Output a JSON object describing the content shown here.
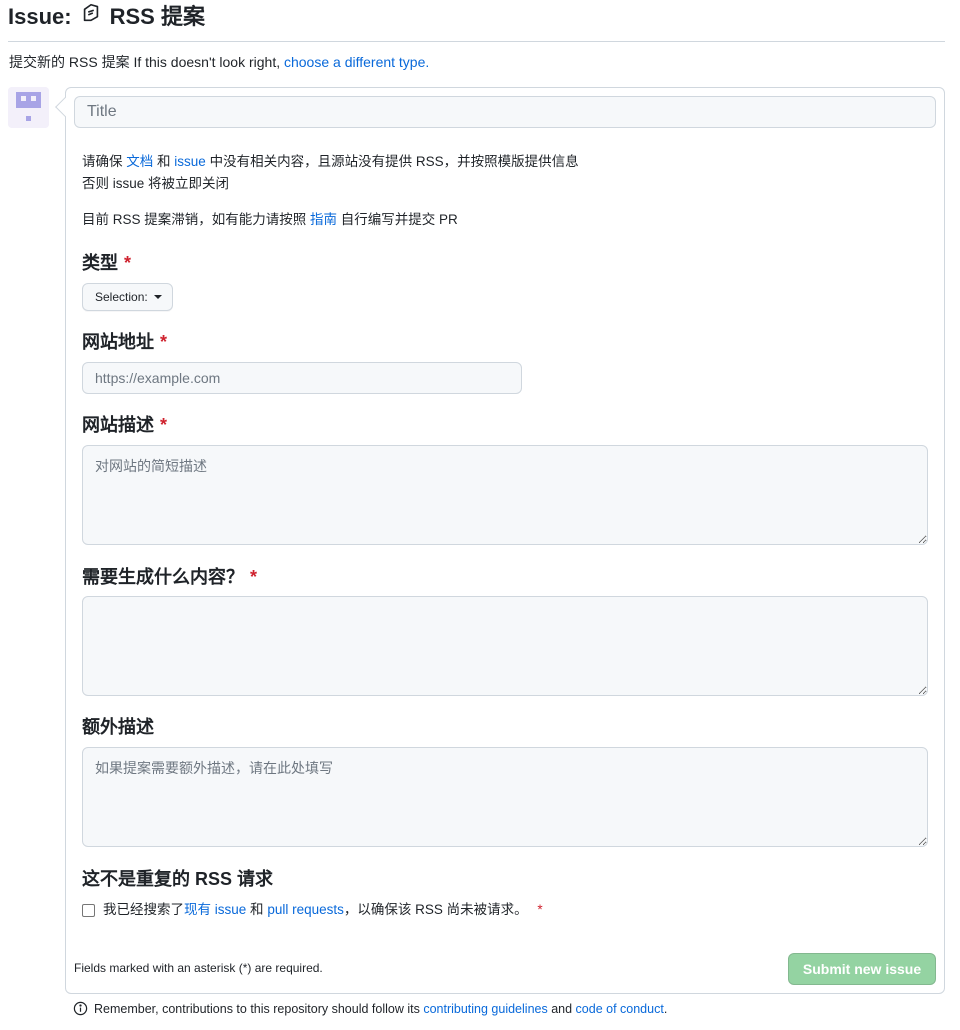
{
  "header": {
    "title_prefix": "Issue:",
    "title_name": "RSS 提案",
    "type_note_text": "提交新的 RSS 提案 If this doesn't look right,",
    "type_note_link": "choose a different type."
  },
  "title_input": {
    "placeholder": "Title"
  },
  "intro": {
    "line1_a": "请确保",
    "link_docs": "文档",
    "line1_b": "和",
    "link_issue": "issue",
    "line1_c": "中没有相关内容，且源站没有提供 RSS，并按照模版提供信息",
    "line2": "否则 issue 将被立即关闭",
    "line3_a": "目前 RSS 提案滞销，如有能力请按照",
    "link_guide": "指南",
    "line3_b": "自行编写并提交 PR"
  },
  "fields": {
    "type": {
      "label": "类型",
      "required_mark": "*",
      "select_value": "Selection:"
    },
    "url": {
      "label": "网站地址",
      "required_mark": "*",
      "placeholder": "https://example.com"
    },
    "description": {
      "label": "网站描述",
      "required_mark": "*",
      "placeholder": "对网站的简短描述"
    },
    "content": {
      "label": "需要生成什么内容？",
      "required_mark": "*",
      "placeholder": ""
    },
    "extra": {
      "label": "额外描述",
      "placeholder": "如果提案需要额外描述，请在此处填写"
    }
  },
  "duplicate": {
    "heading": "这不是重复的 RSS 请求",
    "checkbox_a": "我已经搜索了",
    "link_existing_issue": "现有 issue",
    "checkbox_b": "和",
    "link_pull_requests": "pull requests",
    "checkbox_c": "，以确保该 RSS 尚未被请求。",
    "required_mark": "*"
  },
  "footer": {
    "required_note": "Fields marked with an asterisk (*) are required.",
    "submit_label": "Submit new issue",
    "contrib_a": "Remember, contributions to this repository should follow its",
    "link_guidelines": "contributing guidelines",
    "contrib_b": "and",
    "link_conduct": "code of conduct",
    "contrib_c": "."
  },
  "colors": {
    "link": "#0969da",
    "required": "#cf222e",
    "submit_disabled": "#94d3a2",
    "border": "#d0d7de"
  },
  "icons": {
    "title_icon": "memo-icon",
    "info_icon": "info-icon",
    "select_caret": "caret-down-icon"
  }
}
